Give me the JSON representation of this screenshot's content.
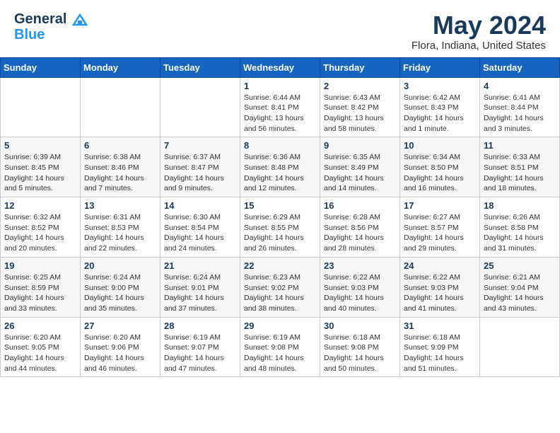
{
  "header": {
    "logo_line1": "General",
    "logo_line2": "Blue",
    "month_title": "May 2024",
    "location": "Flora, Indiana, United States"
  },
  "days_of_week": [
    "Sunday",
    "Monday",
    "Tuesday",
    "Wednesday",
    "Thursday",
    "Friday",
    "Saturday"
  ],
  "weeks": [
    [
      {
        "day": "",
        "info": ""
      },
      {
        "day": "",
        "info": ""
      },
      {
        "day": "",
        "info": ""
      },
      {
        "day": "1",
        "info": "Sunrise: 6:44 AM\nSunset: 8:41 PM\nDaylight: 13 hours\nand 56 minutes."
      },
      {
        "day": "2",
        "info": "Sunrise: 6:43 AM\nSunset: 8:42 PM\nDaylight: 13 hours\nand 58 minutes."
      },
      {
        "day": "3",
        "info": "Sunrise: 6:42 AM\nSunset: 8:43 PM\nDaylight: 14 hours\nand 1 minute."
      },
      {
        "day": "4",
        "info": "Sunrise: 6:41 AM\nSunset: 8:44 PM\nDaylight: 14 hours\nand 3 minutes."
      }
    ],
    [
      {
        "day": "5",
        "info": "Sunrise: 6:39 AM\nSunset: 8:45 PM\nDaylight: 14 hours\nand 5 minutes."
      },
      {
        "day": "6",
        "info": "Sunrise: 6:38 AM\nSunset: 8:46 PM\nDaylight: 14 hours\nand 7 minutes."
      },
      {
        "day": "7",
        "info": "Sunrise: 6:37 AM\nSunset: 8:47 PM\nDaylight: 14 hours\nand 9 minutes."
      },
      {
        "day": "8",
        "info": "Sunrise: 6:36 AM\nSunset: 8:48 PM\nDaylight: 14 hours\nand 12 minutes."
      },
      {
        "day": "9",
        "info": "Sunrise: 6:35 AM\nSunset: 8:49 PM\nDaylight: 14 hours\nand 14 minutes."
      },
      {
        "day": "10",
        "info": "Sunrise: 6:34 AM\nSunset: 8:50 PM\nDaylight: 14 hours\nand 16 minutes."
      },
      {
        "day": "11",
        "info": "Sunrise: 6:33 AM\nSunset: 8:51 PM\nDaylight: 14 hours\nand 18 minutes."
      }
    ],
    [
      {
        "day": "12",
        "info": "Sunrise: 6:32 AM\nSunset: 8:52 PM\nDaylight: 14 hours\nand 20 minutes."
      },
      {
        "day": "13",
        "info": "Sunrise: 6:31 AM\nSunset: 8:53 PM\nDaylight: 14 hours\nand 22 minutes."
      },
      {
        "day": "14",
        "info": "Sunrise: 6:30 AM\nSunset: 8:54 PM\nDaylight: 14 hours\nand 24 minutes."
      },
      {
        "day": "15",
        "info": "Sunrise: 6:29 AM\nSunset: 8:55 PM\nDaylight: 14 hours\nand 26 minutes."
      },
      {
        "day": "16",
        "info": "Sunrise: 6:28 AM\nSunset: 8:56 PM\nDaylight: 14 hours\nand 28 minutes."
      },
      {
        "day": "17",
        "info": "Sunrise: 6:27 AM\nSunset: 8:57 PM\nDaylight: 14 hours\nand 29 minutes."
      },
      {
        "day": "18",
        "info": "Sunrise: 6:26 AM\nSunset: 8:58 PM\nDaylight: 14 hours\nand 31 minutes."
      }
    ],
    [
      {
        "day": "19",
        "info": "Sunrise: 6:25 AM\nSunset: 8:59 PM\nDaylight: 14 hours\nand 33 minutes."
      },
      {
        "day": "20",
        "info": "Sunrise: 6:24 AM\nSunset: 9:00 PM\nDaylight: 14 hours\nand 35 minutes."
      },
      {
        "day": "21",
        "info": "Sunrise: 6:24 AM\nSunset: 9:01 PM\nDaylight: 14 hours\nand 37 minutes."
      },
      {
        "day": "22",
        "info": "Sunrise: 6:23 AM\nSunset: 9:02 PM\nDaylight: 14 hours\nand 38 minutes."
      },
      {
        "day": "23",
        "info": "Sunrise: 6:22 AM\nSunset: 9:03 PM\nDaylight: 14 hours\nand 40 minutes."
      },
      {
        "day": "24",
        "info": "Sunrise: 6:22 AM\nSunset: 9:03 PM\nDaylight: 14 hours\nand 41 minutes."
      },
      {
        "day": "25",
        "info": "Sunrise: 6:21 AM\nSunset: 9:04 PM\nDaylight: 14 hours\nand 43 minutes."
      }
    ],
    [
      {
        "day": "26",
        "info": "Sunrise: 6:20 AM\nSunset: 9:05 PM\nDaylight: 14 hours\nand 44 minutes."
      },
      {
        "day": "27",
        "info": "Sunrise: 6:20 AM\nSunset: 9:06 PM\nDaylight: 14 hours\nand 46 minutes."
      },
      {
        "day": "28",
        "info": "Sunrise: 6:19 AM\nSunset: 9:07 PM\nDaylight: 14 hours\nand 47 minutes."
      },
      {
        "day": "29",
        "info": "Sunrise: 6:19 AM\nSunset: 9:08 PM\nDaylight: 14 hours\nand 48 minutes."
      },
      {
        "day": "30",
        "info": "Sunrise: 6:18 AM\nSunset: 9:08 PM\nDaylight: 14 hours\nand 50 minutes."
      },
      {
        "day": "31",
        "info": "Sunrise: 6:18 AM\nSunset: 9:09 PM\nDaylight: 14 hours\nand 51 minutes."
      },
      {
        "day": "",
        "info": ""
      }
    ]
  ]
}
